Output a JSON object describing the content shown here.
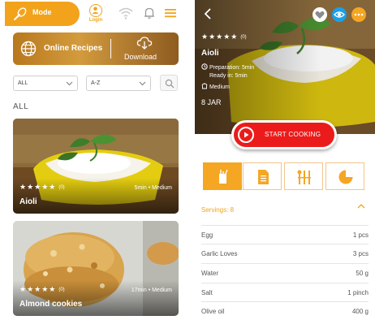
{
  "colors": {
    "accent": "#f2a31b",
    "start": "#ec1b1b",
    "love": "#ffffff",
    "eye": "#1aa0e8",
    "more": "#f5a623"
  },
  "left": {
    "header": {
      "mode_label": "Mode",
      "login_label": "Login"
    },
    "banner": {
      "online_label": "Online Recipes",
      "download_label": "Download"
    },
    "filters": {
      "category_value": "ALL",
      "sort_value": "A-Z"
    },
    "section_label": "ALL",
    "recipes": [
      {
        "title": "Aioli",
        "rating_count": "(0)",
        "meta": "5min • Medium",
        "stars": "★★★★★"
      },
      {
        "title": "Almond cookies",
        "rating_count": "(0)",
        "meta": "17min • Medium",
        "stars": "★★★★★"
      }
    ]
  },
  "right": {
    "detail": {
      "stars": "★★★★★",
      "rating_count": "(0)",
      "title": "Aioli",
      "preparation": "Preparation: 5min",
      "ready": "Ready in: 5min",
      "difficulty": "Medium",
      "yield": "8 JAR",
      "start_label": "START COOKING"
    },
    "servings_label": "Servings: 8",
    "ingredients": [
      {
        "name": "Egg",
        "qty": "1 pcs"
      },
      {
        "name": "Garlic Loves",
        "qty": "3 pcs"
      },
      {
        "name": "Water",
        "qty": "50 g"
      },
      {
        "name": "Salt",
        "qty": "1 pinch"
      },
      {
        "name": "Olive oil",
        "qty": "400 g"
      }
    ]
  }
}
